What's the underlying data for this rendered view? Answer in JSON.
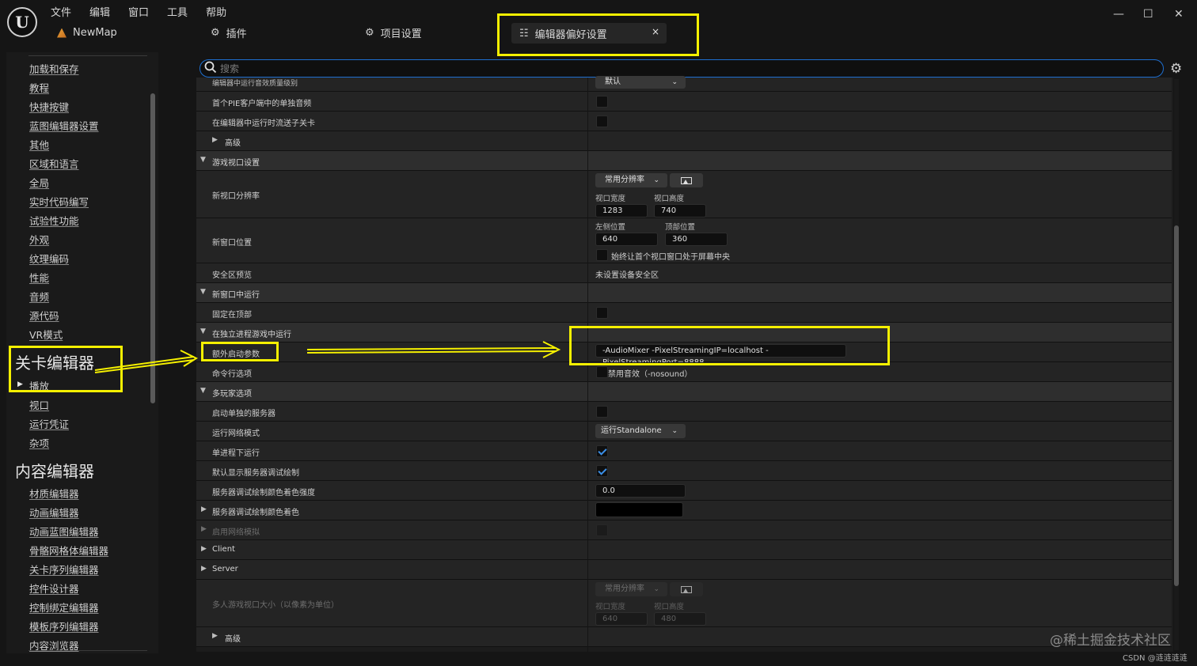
{
  "app": {
    "logo_text": "U",
    "menu": [
      "文件",
      "编辑",
      "窗口",
      "工具",
      "帮助"
    ],
    "map_name": "NewMap",
    "window_controls": {
      "minimize": "—",
      "maximize": "☐",
      "close": "✕"
    }
  },
  "tabs": [
    {
      "label": "插件",
      "icon": "plug-icon",
      "glyph": "⚙"
    },
    {
      "label": "项目设置",
      "icon": "project-settings-icon",
      "glyph": "⚙"
    },
    {
      "label": "编辑器偏好设置",
      "icon": "sliders-icon",
      "glyph": "☷",
      "active": true,
      "close": "×"
    }
  ],
  "search": {
    "placeholder": "搜索",
    "value": ""
  },
  "sidebar": {
    "items": [
      "加载和保存",
      "教程",
      "快捷按键",
      "蓝图编辑器设置",
      "其他",
      "区域和语言",
      "全局",
      "实时代码编写",
      "试验性功能",
      "外观",
      "纹理编码",
      "性能",
      "音频",
      "源代码",
      "VR模式"
    ],
    "section_level_editor": "关卡编辑器",
    "level_editor_items": [
      "播放",
      "视口",
      "运行凭证",
      "杂项"
    ],
    "section_content_editor": "内容编辑器",
    "content_editor_items": [
      "材质编辑器",
      "动画编辑器",
      "动画蓝图编辑器",
      "骨骼网格体编辑器",
      "关卡序列编辑器",
      "控件设计器",
      "控制绑定编辑器",
      "模板序列编辑器",
      "内容浏览器"
    ]
  },
  "details": {
    "row_cutoff": {
      "label": "编辑器中运行音效质量级别",
      "value": "默认"
    },
    "row_first_pie_only_audio": "首个PIE客户端中的单独音频",
    "row_stream_sublevels": "在编辑器中运行时流送子关卡",
    "adv_1": "高级",
    "cat_game_viewport": "游戏视口设置",
    "new_viewport_resolution": {
      "label": "新视口分辨率",
      "preset": "常用分辨率",
      "width_label": "视口宽度",
      "height_label": "视口高度",
      "width": "1283",
      "height": "740"
    },
    "new_window_position": {
      "label": "新窗口位置",
      "left_label": "左侧位置",
      "top_label": "顶部位置",
      "left": "640",
      "top": "360",
      "center_label": "始终让首个视口窗口处于屏幕中央"
    },
    "safe_zone": {
      "label": "安全区预览",
      "value": "未设置设备安全区"
    },
    "cat_new_window": "新窗口中运行",
    "always_on_top": "固定在顶部",
    "cat_standalone": "在独立进程游戏中运行",
    "extra_launch_params": {
      "label": "额外启动参数",
      "value": "-AudioMixer -PixelStreamingIP=localhost -PixelStreamingPort=8888"
    },
    "command_line": {
      "label": "命令行选项",
      "option": "禁用音效（-nosound）"
    },
    "cat_multiplayer": "多玩家选项",
    "launch_separate_server": "启动单独的服务器",
    "play_net_mode": {
      "label": "运行网络模式",
      "value": "运行Standalone"
    },
    "run_under_one_process": {
      "label": "单进程下运行",
      "checked": true
    },
    "show_server_debug_drawing": {
      "label": "默认显示服务器调试绘制",
      "checked": true
    },
    "server_debug_tint_strength": {
      "label": "服务器调试绘制颜色着色强度",
      "value": "0.0"
    },
    "server_debug_tint": {
      "label": "服务器调试绘制颜色着色",
      "value_color": "#000000"
    },
    "network_emulation": "启用网络模拟",
    "cat_client": "Client",
    "cat_server": "Server",
    "multiplayer_viewport_size": {
      "label": "多人游戏视口大小（以像素为单位）",
      "preset": "常用分辨率",
      "width_label": "视口宽度",
      "height_label": "视口高度",
      "width": "640",
      "height": "480"
    },
    "adv_2": "高级"
  },
  "watermarks": [
    "@稀土掘金技术社区",
    "CSDN @涟涟涟涟"
  ],
  "colors": {
    "highlight": "#f5f000",
    "accent": "#1e6fd0",
    "check": "#3a8ee6"
  }
}
